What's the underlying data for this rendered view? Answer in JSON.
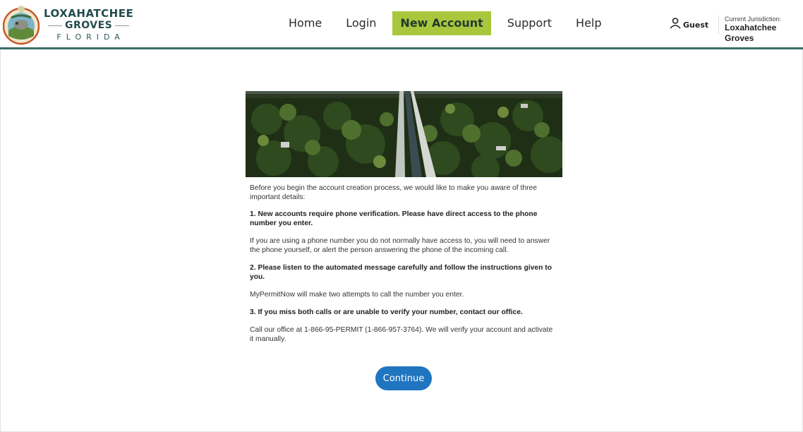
{
  "logo": {
    "line1": "LOXAHATCHEE",
    "line2": "GROVES",
    "line3": "FLORIDA"
  },
  "nav": {
    "items": [
      {
        "label": "Home"
      },
      {
        "label": "Login"
      },
      {
        "label": "New Account",
        "active": true
      },
      {
        "label": "Support"
      },
      {
        "label": "Help"
      }
    ]
  },
  "user": {
    "name": "Guest"
  },
  "jurisdiction": {
    "label": "Current Jurisdiction:",
    "value": "Loxahatchee Groves"
  },
  "content": {
    "intro": "Before you begin the account creation process, we would like to make you aware of three important details:",
    "point1_title": "1. New accounts require phone verification. Please have direct access to the phone number you enter.",
    "point1_body": "If you are using a phone number you do not normally have access to, you will need to answer the phone yourself, or alert the person answering the phone of the incoming call.",
    "point2_title": "2. Please listen to the automated message carefully and follow the instructions given to you.",
    "point2_body": "MyPermitNow will make two attempts to call the number you enter.",
    "point3_title": "3. If you miss both calls or are unable to verify your number, contact our office.",
    "point3_body": "Call our office at 1-866-95-PERMIT (1-866-957-3764). We will verify your account and activate it manually."
  },
  "actions": {
    "continue_label": "Continue"
  },
  "colors": {
    "accent_nav": "#a8c73c",
    "header_rule": "#3c6e68",
    "button": "#1f75bf"
  }
}
